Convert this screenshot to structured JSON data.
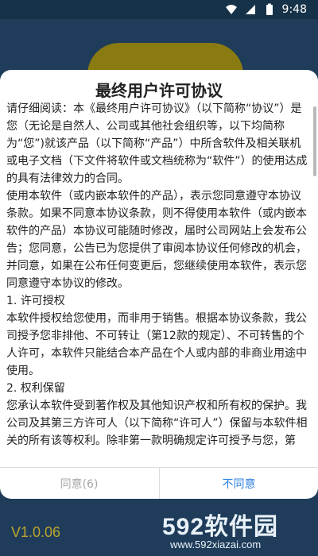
{
  "status_bar": {
    "time": "9:48"
  },
  "app": {
    "version": "V1.0.06"
  },
  "watermark": {
    "logo": "592软件园",
    "url": "www.592xiazai.com"
  },
  "dialog": {
    "title": "最终用户许可协议",
    "paragraphs": [
      "请仔细阅读：本《最终用户许可协议》（以下简称“协议”）是您（无论是自然人、公司或其他社会组织等，以下均简称为“您”)就该产品（以下简称“产品”）中所含软件及相关联机或电子文档（下文件将软件或文档统称为“软件”）的使用达成的具有法律效力的合同。",
      "使用本软件（或内嵌本软件的产品），表示您同意遵守本协议条款。如果不同意本协议条款，则不得使用本软件（或内嵌本软件的产品）本协议可能随时修改，届时公司网站上会发布公告；您同意，公告已为您提供了审阅本协议任何修改的机会，并同意，如果在公布任何变更后，您继续使用本软件，表示您同意遵守本协议的修改。",
      "1. 许可授权",
      "本软件授权给您使用，而非用于销售。根据本协议条款，我公司授予您非排他、不可转让（第12款的规定）、不可转售的个人许可，本软件只能结合本产品在个人或内部的非商业用途中使用。",
      "2. 权利保留",
      "您承认本软件受到著作权及其他知识产权和所有权的保护。我公司及其第三方许可人（以下简称“许可人”）保留与本软件相关的所有该等权利。除非第一款明确规定许可授予与您，第"
    ],
    "agree_label": "同意(6)",
    "disagree_label": "不同意"
  }
}
